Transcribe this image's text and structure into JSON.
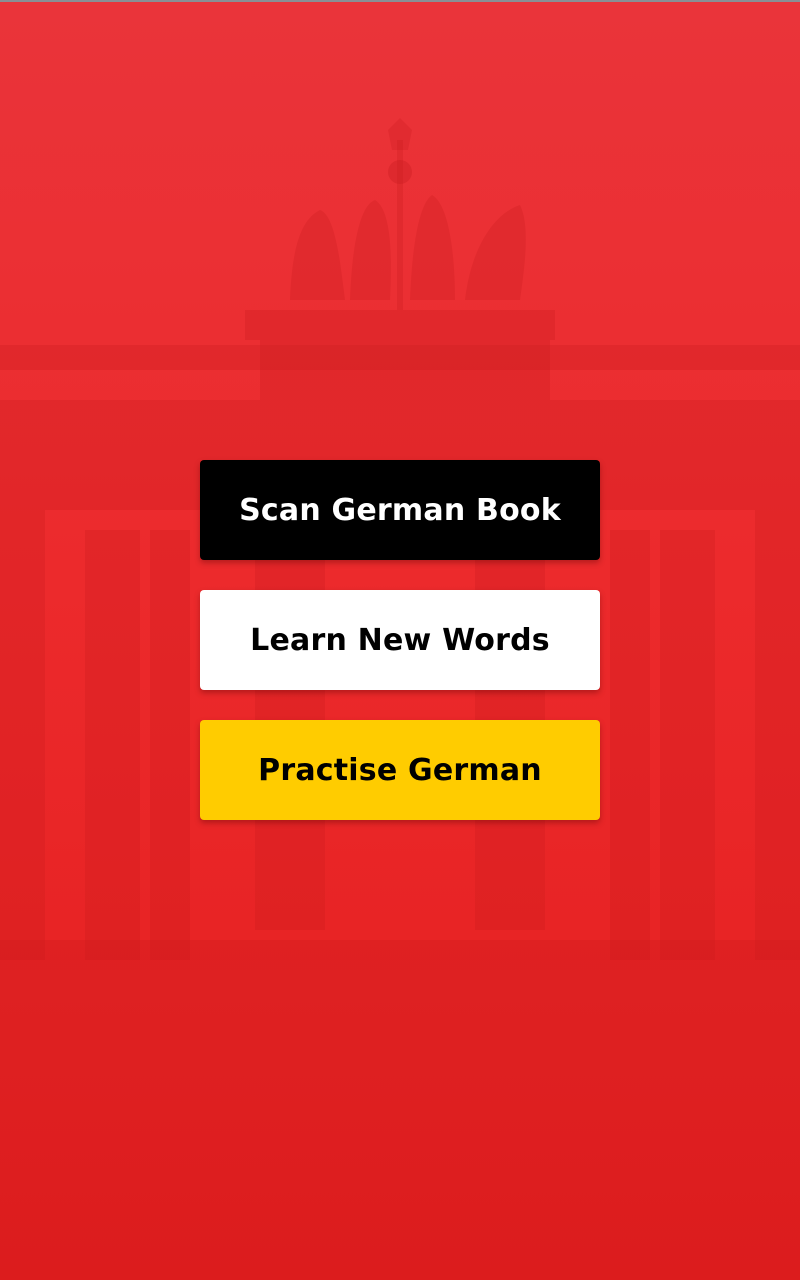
{
  "background": {
    "description_icon": "brandenburg-gate-silhouette",
    "base_color": "#e82a2c"
  },
  "menu": {
    "buttons": [
      {
        "label": "Scan German Book",
        "color": "#000000",
        "text_color": "#ffffff"
      },
      {
        "label": "Learn New Words",
        "color": "#ffffff",
        "text_color": "#000000"
      },
      {
        "label": "Practise German",
        "color": "#ffcc00",
        "text_color": "#000000"
      }
    ]
  }
}
